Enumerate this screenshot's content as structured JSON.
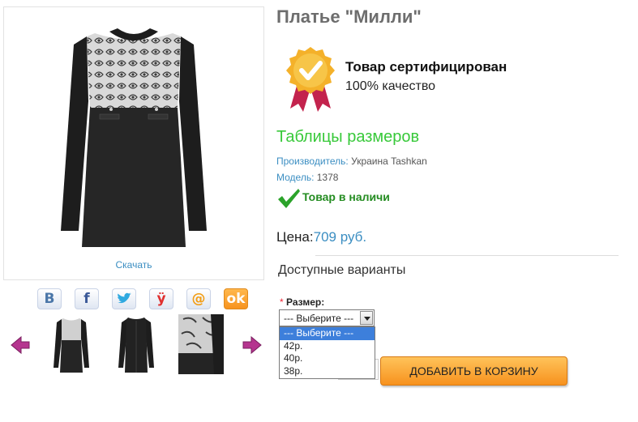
{
  "product": {
    "title": "Платье \"Милли\"",
    "download_label": "Скачать"
  },
  "certification": {
    "title": "Товар сертифицирован",
    "subtitle": "100% качество"
  },
  "size_table_link": "Таблицы размеров",
  "manufacturer": {
    "label": "Производитель:",
    "value": "Украина Tashkan"
  },
  "model": {
    "label": "Модель:",
    "value": "1378"
  },
  "stock_status": "Товар в наличи",
  "price": {
    "label": "Цена:",
    "value": "709 руб."
  },
  "options_title": "Доступные варианты",
  "size_option": {
    "required_mark": "*",
    "label": "Размер:",
    "selected": "--- Выберите ---",
    "options": [
      "--- Выберите ---",
      "42р.",
      "40р.",
      "38р."
    ]
  },
  "add_to_cart_label": "ДОБАВИТЬ В КОРЗИНУ",
  "social_icons": [
    "vk-icon",
    "facebook-icon",
    "twitter-icon",
    "odnoklassniki-icon",
    "mail-ru-icon",
    "odnoklassniki-orange-icon"
  ],
  "colors": {
    "accent_blue": "#3b8ec2",
    "green_link": "#38c93a",
    "stock_green": "#248c21",
    "cart_orange": "#f7921e"
  }
}
